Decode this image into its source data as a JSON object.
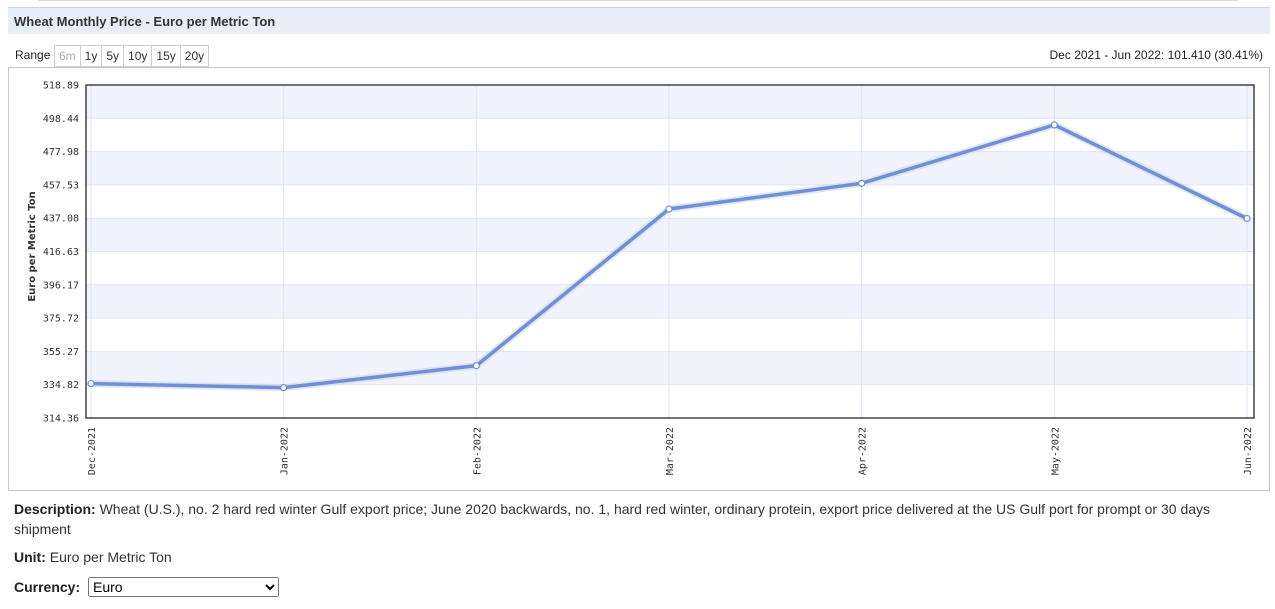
{
  "title": "Wheat Monthly Price - Euro per Metric Ton",
  "range": {
    "label": "Range",
    "buttons": [
      "6m",
      "1y",
      "5y",
      "10y",
      "15y",
      "20y"
    ],
    "disabled": [
      "6m"
    ]
  },
  "change_summary": "Dec 2021 - Jun 2022: 101.410 (30.41%)",
  "description": {
    "label": "Description:",
    "text": "Wheat (U.S.), no. 2 hard red winter Gulf export price; June 2020 backwards, no. 1, hard red winter, ordinary protein, export price delivered at the US Gulf port for prompt or 30 days shipment"
  },
  "unit": {
    "label": "Unit:",
    "text": "Euro per Metric Ton"
  },
  "currency": {
    "label": "Currency:",
    "selected": "Euro"
  },
  "colors": {
    "line": "#7090d6",
    "band": "#f0f3fb",
    "grid": "#dfe4f2"
  },
  "chart_data": {
    "type": "line",
    "ylabel": "Euro per Metric Ton",
    "xlabel": "",
    "categories": [
      "Dec-2021",
      "Jan-2022",
      "Feb-2022",
      "Mar-2022",
      "Apr-2022",
      "May-2022",
      "Jun-2022"
    ],
    "series": [
      {
        "values": [
          335.5,
          333.0,
          346.5,
          442.7,
          458.5,
          494.4,
          436.9
        ]
      }
    ],
    "yticks": [
      "518.89",
      "498.44",
      "477.98",
      "457.53",
      "437.08",
      "416.63",
      "396.17",
      "375.72",
      "355.27",
      "334.82",
      "314.36"
    ],
    "ylim": [
      314.36,
      518.89
    ],
    "grid": true
  }
}
